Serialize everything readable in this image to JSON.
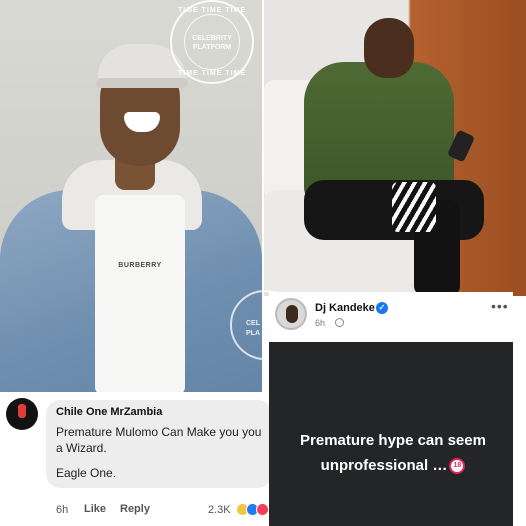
{
  "watermark": {
    "top": "TIME TIME TIME",
    "line1": "CELEBRITY",
    "line2": "PLATFORM",
    "bottom": "TIME TIME TIME",
    "partial1": "CEL",
    "partial2": "PLA"
  },
  "left_photo": {
    "shirt_brand": "BURBERRY"
  },
  "comment": {
    "author": "Chile One MrZambia",
    "text": "Premature Mulomo Can Make you you a Wizard.",
    "sign_off": "Eagle One.",
    "time": "6h",
    "like_label": "Like",
    "reply_label": "Reply",
    "reaction_count": "2.3K",
    "reaction_icons": [
      "haha-icon",
      "like-icon",
      "love-icon"
    ]
  },
  "post": {
    "author": "Dj Kandeke",
    "verified": true,
    "time": "6h",
    "privacy_icon": "globe-icon",
    "more_label": "•••",
    "text": "Premature hype can seem unprofessional …",
    "emoji_label": "18",
    "background_color": "#242526"
  }
}
